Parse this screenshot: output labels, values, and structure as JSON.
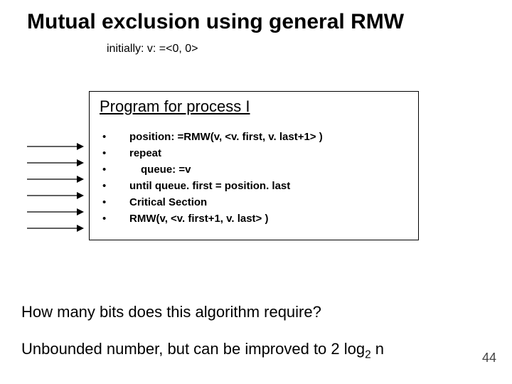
{
  "title": "Mutual exclusion using general RMW",
  "subtitle": "initially: v: =<0, 0>",
  "program": {
    "header": "Program for process I",
    "lines": [
      "position: =RMW(v, <v. first, v. last+1> )",
      "repeat",
      "queue: =v",
      "until queue. first = position. last",
      "Critical Section",
      "RMW(v, <v. first+1, v. last> )"
    ]
  },
  "question": "How many bits does this algorithm require?",
  "answer_prefix": "Unbounded number, but can be improved to 2 log",
  "answer_sub": "2",
  "answer_suffix": " n",
  "page_number": "44"
}
